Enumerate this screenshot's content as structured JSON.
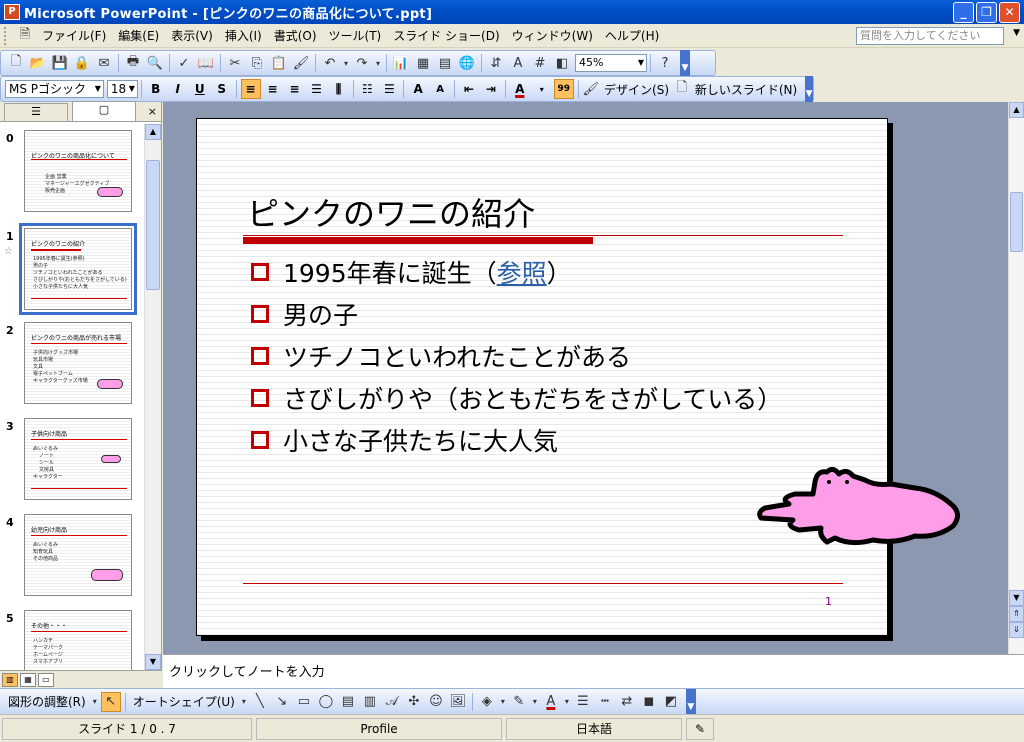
{
  "window": {
    "app_icon": "P",
    "title": "Microsoft PowerPoint - [ピンクのワニの商品化について.ppt]",
    "minimize_label": "_",
    "restore_label": "❐",
    "close_label": "✕"
  },
  "menu": {
    "items": [
      "ファイル(F)",
      "編集(E)",
      "表示(V)",
      "挿入(I)",
      "書式(O)",
      "ツール(T)",
      "スライド ショー(D)",
      "ウィンドウ(W)",
      "ヘルプ(H)"
    ],
    "help_placeholder": "質問を入力してください"
  },
  "standard_toolbar": {
    "zoom": "45%"
  },
  "format_toolbar": {
    "font_name": "MS Pゴシック",
    "font_size": "18",
    "bold": "B",
    "italic": "I",
    "underline": "U",
    "shadow": "S",
    "design_label": "デザイン(S)",
    "new_slide_label": "新しいスライド(N)"
  },
  "outline_pane": {
    "tab_outline": "☰",
    "tab_slides": "▢",
    "close": "×",
    "thumbnails": [
      {
        "num": "0",
        "title": "ピンクのワニの商品化について",
        "bullets": [
          "企画 営業",
          "マネージャーエグゼクティブ",
          "販売企画"
        ]
      },
      {
        "num": "1",
        "title": "ピンクのワニの紹介",
        "bullets": [
          "1995年春に誕生(参照)",
          "男の子",
          "ツチノコといわれたことがある",
          "さびしがりや(おともだちをさがしている)",
          "小さな子供たちに大人気"
        ]
      },
      {
        "num": "2",
        "title": "ピンクのワニの商品が売れる市場",
        "bullets": [
          "子供向けグッズ市場",
          "玩具市場",
          "文具",
          "電子ペットブーム",
          "キャラクターグッズ市場"
        ]
      },
      {
        "num": "3",
        "title": "子供向け商品",
        "bullets": [
          "ぬいぐるみ",
          "ノート",
          "シール",
          "文房具",
          "キャラクター"
        ]
      },
      {
        "num": "4",
        "title": "幼児向け商品",
        "bullets": [
          "ぬいぐるみ",
          "知育玩具",
          "その他商品"
        ]
      },
      {
        "num": "5",
        "title": "その他・・・",
        "bullets": [
          "ハンカチ",
          "テーマパーク",
          "ホームページ",
          "スマホアプリ"
        ]
      }
    ]
  },
  "slide": {
    "title": "ピンクのワニの紹介",
    "bullets": [
      {
        "pre": "1995年春に誕生（",
        "link": "参照",
        "post": "）"
      },
      {
        "pre": "男の子",
        "link": "",
        "post": ""
      },
      {
        "pre": "ツチノコといわれたことがある",
        "link": "",
        "post": ""
      },
      {
        "pre": "さびしがりや（おともだちをさがしている）",
        "link": "",
        "post": ""
      },
      {
        "pre": "小さな子供たちに大人気",
        "link": "",
        "post": ""
      }
    ],
    "slide_number": "1",
    "accent_color": "#c00000",
    "croc_color": "#ff9ee8"
  },
  "notes": {
    "placeholder": "クリックしてノートを入力"
  },
  "draw_toolbar": {
    "adjust_label": "図形の調整(R)",
    "autoshape_label": "オートシェイプ(U)"
  },
  "status": {
    "slide_info": "スライド 1 / 0 . 7",
    "design": "Profile",
    "language": "日本語"
  }
}
